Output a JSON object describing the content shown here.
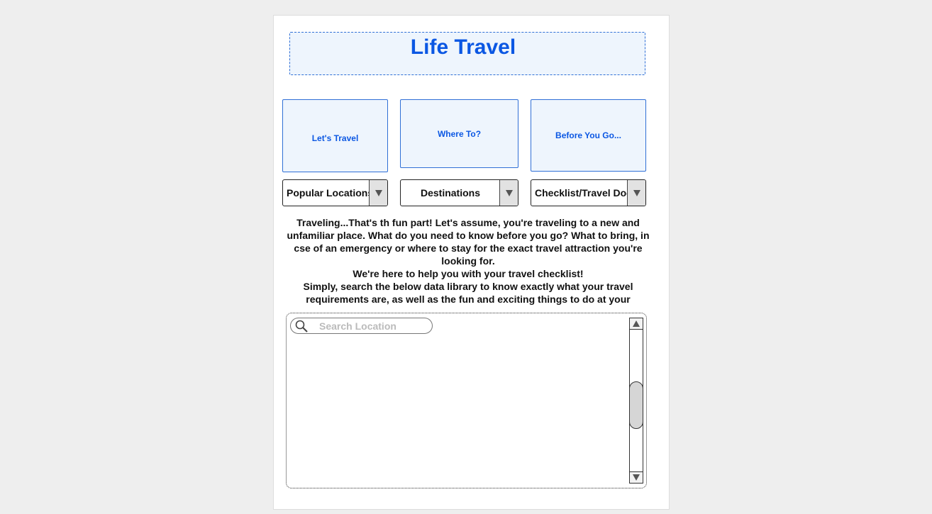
{
  "header": {
    "title": "Life Travel"
  },
  "nav": [
    {
      "label": "Let's Travel"
    },
    {
      "label": "Where To?"
    },
    {
      "label": "Before You Go..."
    }
  ],
  "selects": [
    {
      "value": "Popular Locations"
    },
    {
      "value": "Destinations"
    },
    {
      "value": "Checklist/Travel Documents"
    }
  ],
  "intro": {
    "paragraph1": "Traveling...That's th fun part! Let's assume, you're traveling to a new and unfamiliar place. What do you need to know before you go? What to bring, in cse of an emergency or where to stay for the exact travel attraction you're looking for.",
    "paragraph2": "We're here to help you with your travel checklist!",
    "paragraph3": "Simply, search the below data library to know exactly what your travel requirements are, as well as the fun and exciting things to do at your"
  },
  "library": {
    "search_placeholder": "Search Location",
    "search_icon": "search-icon",
    "scroll_position": 0.45
  },
  "colors": {
    "accent": "#0b57e3",
    "panel": "#eef5fd",
    "background": "#eeeeee"
  }
}
